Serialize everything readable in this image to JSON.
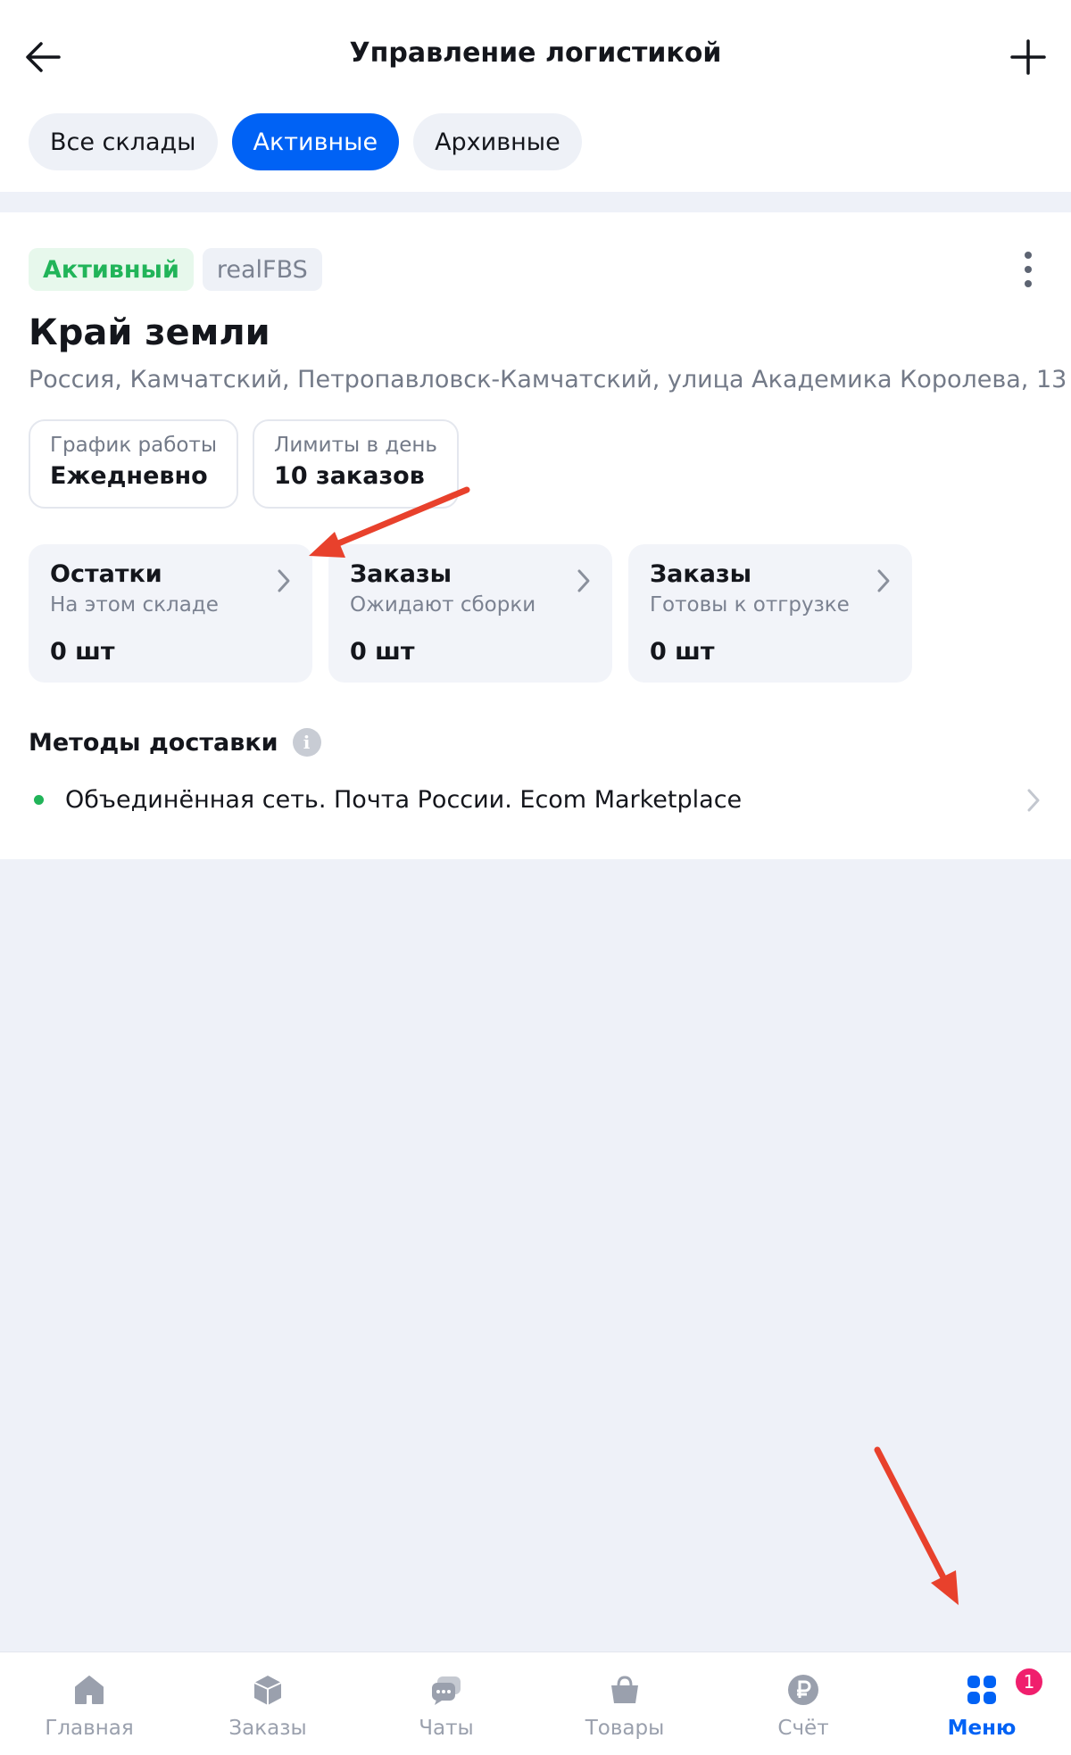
{
  "header": {
    "title": "Управление логистикой",
    "back_icon": "arrow-left-icon",
    "add_icon": "plus-icon"
  },
  "tabs": [
    {
      "label": "Все склады",
      "active": false
    },
    {
      "label": "Активные",
      "active": true
    },
    {
      "label": "Архивные",
      "active": false
    }
  ],
  "warehouse": {
    "status_badge": "Активный",
    "type_badge": "realFBS",
    "name": "Край земли",
    "address": "Россия, Камчатский, Петропавловск-Камчатский, улица Академика Королева, 13",
    "schedule": {
      "label": "График работы",
      "value": "Ежедневно"
    },
    "limits": {
      "label": "Лимиты в день",
      "value": "10 заказов"
    },
    "stats": [
      {
        "title": "Остатки",
        "subtitle": "На этом складе",
        "value": "0 шт"
      },
      {
        "title": "Заказы",
        "subtitle": "Ожидают сборки",
        "value": "0 шт"
      },
      {
        "title": "Заказы",
        "subtitle": "Готовы к отгрузке",
        "value": "0 шт"
      }
    ],
    "delivery": {
      "title": "Методы доставки",
      "info_icon_glyph": "i",
      "methods": [
        "Объединённая сеть. Почта России. Ecom Marketplace"
      ]
    }
  },
  "bottom_nav": [
    {
      "label": "Главная",
      "icon": "home-icon"
    },
    {
      "label": "Заказы",
      "icon": "box-icon"
    },
    {
      "label": "Чаты",
      "icon": "chat-icon"
    },
    {
      "label": "Товары",
      "icon": "basket-icon"
    },
    {
      "label": "Счёт",
      "icon": "ruble-icon"
    },
    {
      "label": "Меню",
      "icon": "menu-grid-icon",
      "active": true,
      "badge": "1"
    }
  ],
  "colors": {
    "accent": "#0062f5",
    "active_green": "#21b459",
    "badge_pink": "#f01f6d",
    "annotation_red": "#e8412c"
  }
}
